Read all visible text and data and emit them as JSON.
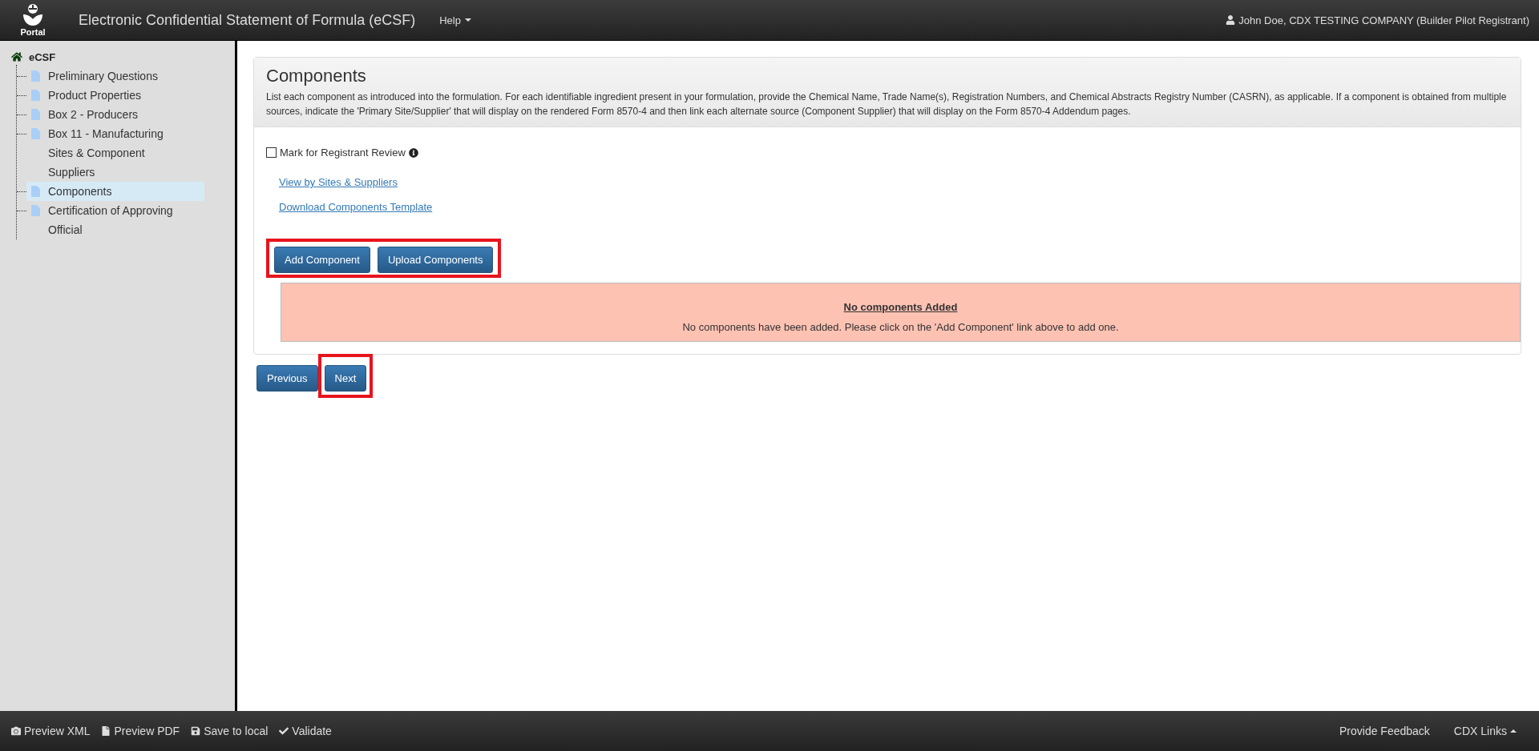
{
  "header": {
    "logo_text": "Portal",
    "title": "Electronic Confidential Statement of Formula (eCSF)",
    "help_menu": "Help",
    "user": "John Doe, CDX TESTING COMPANY (Builder Pilot Registrant)"
  },
  "sidebar": {
    "root": {
      "label": "eCSF",
      "children": [
        {
          "label": "Preliminary Questions",
          "selected": false
        },
        {
          "label": "Product Properties",
          "selected": false
        },
        {
          "label": "Box 2 - Producers",
          "selected": false
        },
        {
          "label": "Box 11 - Manufacturing Sites & Component Suppliers",
          "selected": false
        },
        {
          "label": "Components",
          "selected": true
        },
        {
          "label": "Certification of Approving Official",
          "selected": false
        }
      ]
    }
  },
  "panel": {
    "title": "Components",
    "description": "List each component as introduced into the formulation. For each identifiable ingredient present in your formulation, provide the Chemical Name, Trade Name(s), Registration Numbers, and Chemical Abstracts Registry Number (CASRN), as applicable. If a component is obtained from multiple sources, indicate the 'Primary Site/Supplier' that will display on the rendered Form 8570-4 and then link each alternate source (Component Supplier) that will display on the Form 8570-4 Addendum pages.",
    "review_checkbox": {
      "label": "Mark for Registrant Review",
      "checked": false
    },
    "links": [
      "View by Sites & Suppliers",
      "Download Components Template"
    ],
    "actions": [
      {
        "label": "Add Component"
      },
      {
        "label": "Upload Components"
      }
    ],
    "alert": {
      "title": "No components Added",
      "message": "No components have been added. Please click on the 'Add Component' link above to add one."
    }
  },
  "nav_buttons": [
    {
      "label": "Previous",
      "highlighted": false
    },
    {
      "label": "Next",
      "highlighted": true
    }
  ],
  "footer": {
    "left": [
      {
        "kind": "camera",
        "label": "Preview XML"
      },
      {
        "kind": "file",
        "label": "Preview PDF"
      },
      {
        "kind": "save",
        "label": "Save to local"
      },
      {
        "kind": "check",
        "label": "Validate"
      }
    ],
    "right": [
      {
        "label": "Provide Feedback",
        "caret": false
      },
      {
        "label": "CDX Links",
        "caret": true
      }
    ]
  }
}
